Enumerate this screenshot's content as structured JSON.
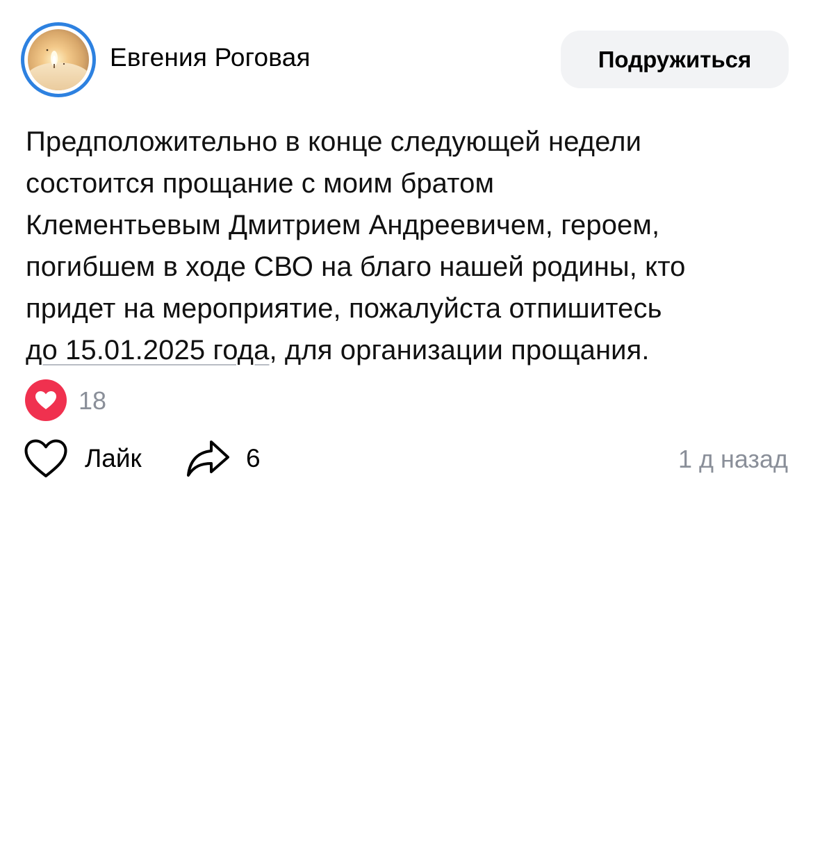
{
  "post": {
    "author": {
      "name": "Евгения Роговая",
      "avatar_icon": "candle-photo",
      "avatar_ring_color": "#2d81e0"
    },
    "friend_button_label": "Подружиться",
    "text": {
      "lines": [
        "Предположительно в конце следующей недели",
        "состоится прощание с моим братом",
        "Клементьевым Дмитрием Андреевичем, героем,",
        "погибшем в ходе СВО на благо нашей родины, кто",
        "придет на мероприятие, пожалуйста отпишитесь"
      ],
      "date_link": "до 15.01.2025 года",
      "last_line_rest": ", для организации прощания."
    },
    "reactions": {
      "icon": "heart-reaction-icon",
      "color": "#f0314f",
      "count": "18"
    },
    "actions": {
      "like_label": "Лайк",
      "like_icon": "heart-outline-icon",
      "share_icon": "share-arrow-icon",
      "share_count": "6"
    },
    "timestamp": "1 д назад"
  }
}
